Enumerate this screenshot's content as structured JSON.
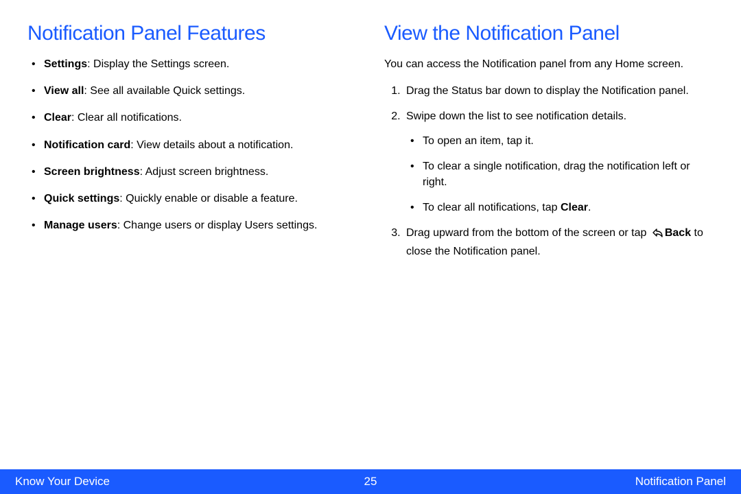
{
  "left": {
    "heading": "Notification Panel Features",
    "items": [
      {
        "term": "Settings",
        "desc": ": Display the Settings screen."
      },
      {
        "term": "View all",
        "desc": ": See all available Quick settings."
      },
      {
        "term": "Clear",
        "desc": ": Clear all notifications."
      },
      {
        "term": "Notification card",
        "desc": ": View details about a notification."
      },
      {
        "term": "Screen brightness",
        "desc": ": Adjust screen brightness."
      },
      {
        "term": "Quick settings",
        "desc": ": Quickly enable or disable a feature."
      },
      {
        "term": "Manage users",
        "desc": ": Change users or display Users settings."
      }
    ]
  },
  "right": {
    "heading": "View the Notification Panel",
    "intro": "You can access the Notification panel from any Home screen.",
    "step1": "Drag the Status bar down to display the Notification panel.",
    "step2": "Swipe down the list to see notification details.",
    "sub1": "To open an item, tap it.",
    "sub2": "To clear a single notification, drag the notification left or right.",
    "sub3_pre": "To clear all notifications, tap ",
    "sub3_bold": "Clear",
    "sub3_post": ".",
    "step3_pre": "Drag upward from the bottom of the screen or tap ",
    "step3_bold": "Back",
    "step3_post": " to close the Notification panel."
  },
  "footer": {
    "left": "Know Your Device",
    "center": "25",
    "right": "Notification Panel"
  }
}
